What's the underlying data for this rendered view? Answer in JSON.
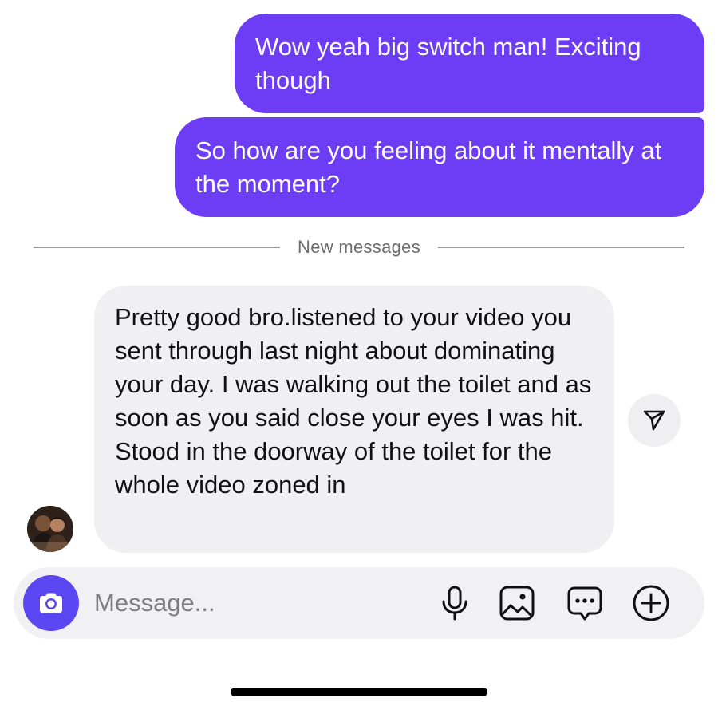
{
  "messages": {
    "outgoing": [
      {
        "text": "Wow yeah big switch man! Exciting though"
      },
      {
        "text": "So how are you feeling about it mentally at the moment?"
      }
    ],
    "divider_label": "New messages",
    "incoming": [
      {
        "text": "Pretty good bro.listened to your video you sent through last night about dominating your day. I was walking out the toilet and as soon as you said close your eyes I was hit. Stood in the doorway of the toilet for the whole video zoned in"
      }
    ]
  },
  "composer": {
    "placeholder": "Message...",
    "value": ""
  },
  "icons": {
    "share": "paper-plane-icon",
    "camera": "camera-icon",
    "mic": "microphone-icon",
    "gallery": "image-icon",
    "sticker": "chat-bubble-icon",
    "add": "plus-circle-icon"
  },
  "colors": {
    "outgoing_bubble": "#6d3df5",
    "incoming_bubble": "#f0f0f2",
    "camera_button": "#5b47f2",
    "composer_bg": "#f1f1f3"
  }
}
